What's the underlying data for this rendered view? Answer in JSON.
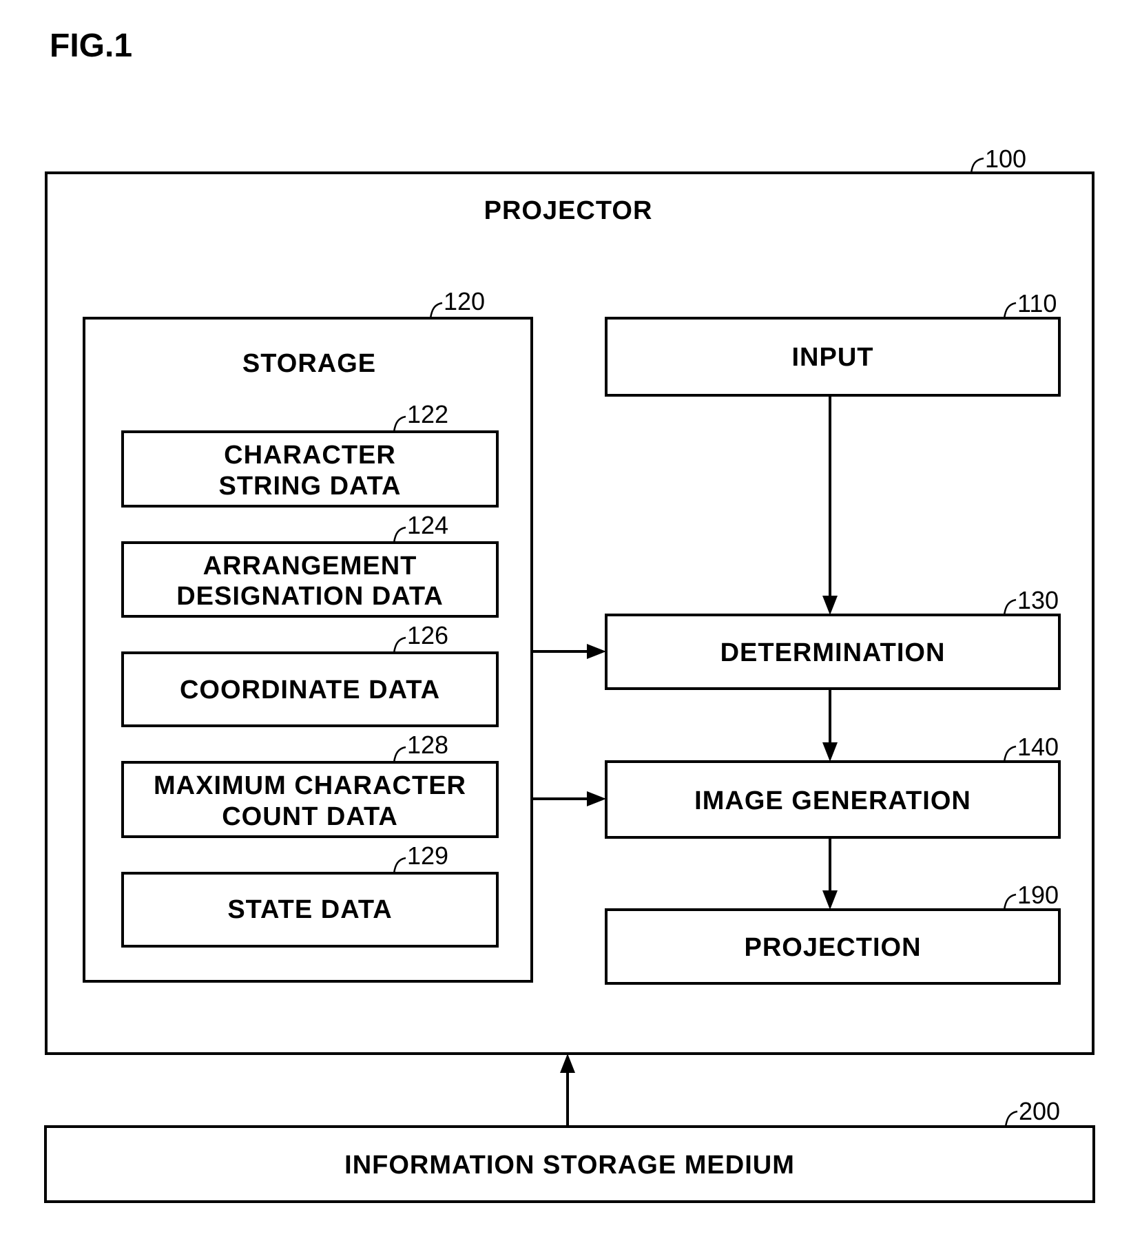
{
  "figure": {
    "title": "FIG.1",
    "projector": {
      "label": "PROJECTOR",
      "ref": "100"
    },
    "storage": {
      "label": "STORAGE",
      "ref": "120",
      "items": [
        {
          "ref": "122",
          "lines": [
            "CHARACTER",
            "STRING DATA"
          ]
        },
        {
          "ref": "124",
          "lines": [
            "ARRANGEMENT",
            "DESIGNATION DATA"
          ]
        },
        {
          "ref": "126",
          "lines": [
            "COORDINATE DATA"
          ]
        },
        {
          "ref": "128",
          "lines": [
            "MAXIMUM CHARACTER",
            "COUNT DATA"
          ]
        },
        {
          "ref": "129",
          "lines": [
            "STATE DATA"
          ]
        }
      ]
    },
    "units": [
      {
        "key": "input",
        "ref": "110",
        "label": "INPUT"
      },
      {
        "key": "determination",
        "ref": "130",
        "label": "DETERMINATION"
      },
      {
        "key": "image_generation",
        "ref": "140",
        "label": "IMAGE GENERATION"
      },
      {
        "key": "projection",
        "ref": "190",
        "label": "PROJECTION"
      }
    ],
    "medium": {
      "ref": "200",
      "label": "INFORMATION STORAGE MEDIUM"
    },
    "connections": [
      {
        "from": "input",
        "to": "determination"
      },
      {
        "from": "storage",
        "to": "determination"
      },
      {
        "from": "determination",
        "to": "image_generation"
      },
      {
        "from": "storage",
        "to": "image_generation"
      },
      {
        "from": "image_generation",
        "to": "projection"
      },
      {
        "from": "medium",
        "to": "projector"
      }
    ]
  }
}
